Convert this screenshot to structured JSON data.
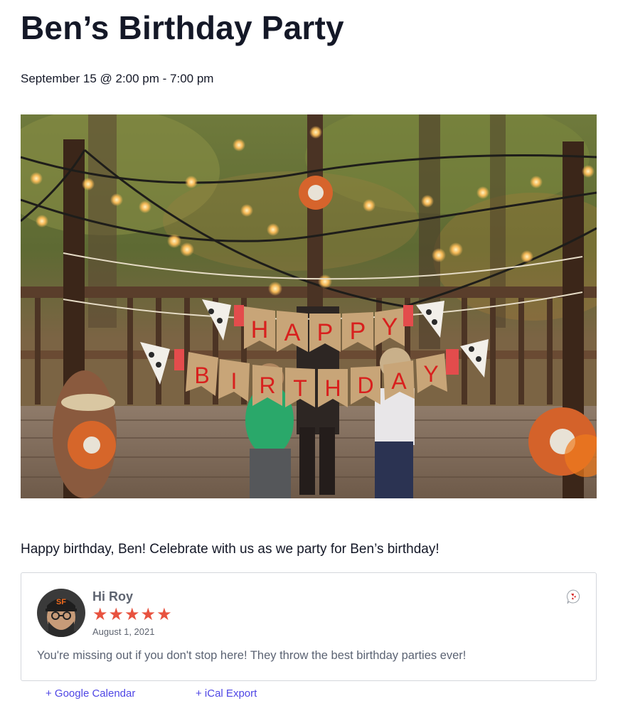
{
  "event": {
    "title": "Ben’s Birthday Party",
    "datetime": "September 15 @ 2:00 pm - 7:00 pm",
    "description": "Happy birthday, Ben! Celebrate with us as we party for Ben’s birthday!",
    "image": {
      "banner_line_1": [
        "H",
        "A",
        "P",
        "P",
        "Y"
      ],
      "banner_line_2": [
        "B",
        "I",
        "R",
        "T",
        "H",
        "D",
        "A",
        "Y"
      ]
    }
  },
  "review": {
    "reviewer_name": "Hi Roy",
    "rating": 5,
    "stars": [
      "★",
      "★",
      "★",
      "★",
      "★"
    ],
    "date": "August 1, 2021",
    "text": "You're missing out if you don't stop here! They throw the best birthday parties ever!",
    "source_icon": "yelp-icon",
    "star_color": "#e8523f"
  },
  "calendar": {
    "google_label": "+ Google Calendar",
    "ical_label": "+ iCal Export"
  },
  "colors": {
    "title": "#141827",
    "link": "#4f46e5",
    "card_border": "#d4d7dc",
    "muted_text": "#5b6373"
  }
}
